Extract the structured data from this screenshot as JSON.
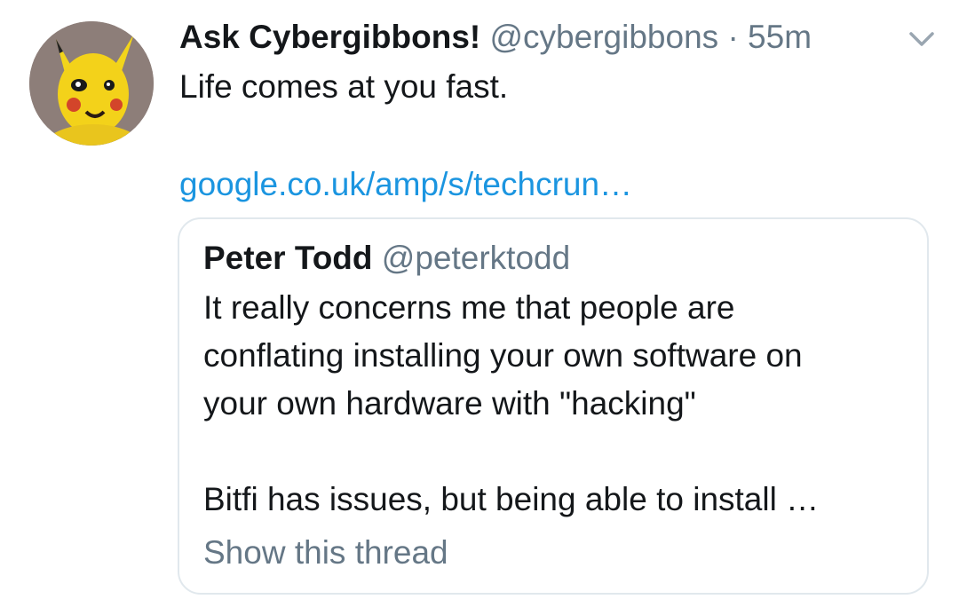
{
  "tweet": {
    "display_name": "Ask Cybergibbons!",
    "handle": "@cybergibbons",
    "separator": "·",
    "time": "55m",
    "caret_icon": "chevron-down-icon",
    "text": "Life comes at you fast.",
    "link_text": "google.co.uk/amp/s/techcrun…",
    "avatar_icon": "avatar-yellow-face"
  },
  "quoted_tweet": {
    "display_name": "Peter Todd",
    "handle": "@peterktodd",
    "lines": [
      "It really concerns me that people are",
      "conflating installing your own software on",
      "your own hardware with \"hacking\""
    ],
    "truncated_line": "Bitfi has issues, but being able to install …",
    "show_thread_label": "Show this thread"
  },
  "colors": {
    "text_primary": "#14171a",
    "text_secondary": "#657786",
    "link": "#1b95e0",
    "border": "#e1e8ed",
    "background": "#ffffff"
  }
}
